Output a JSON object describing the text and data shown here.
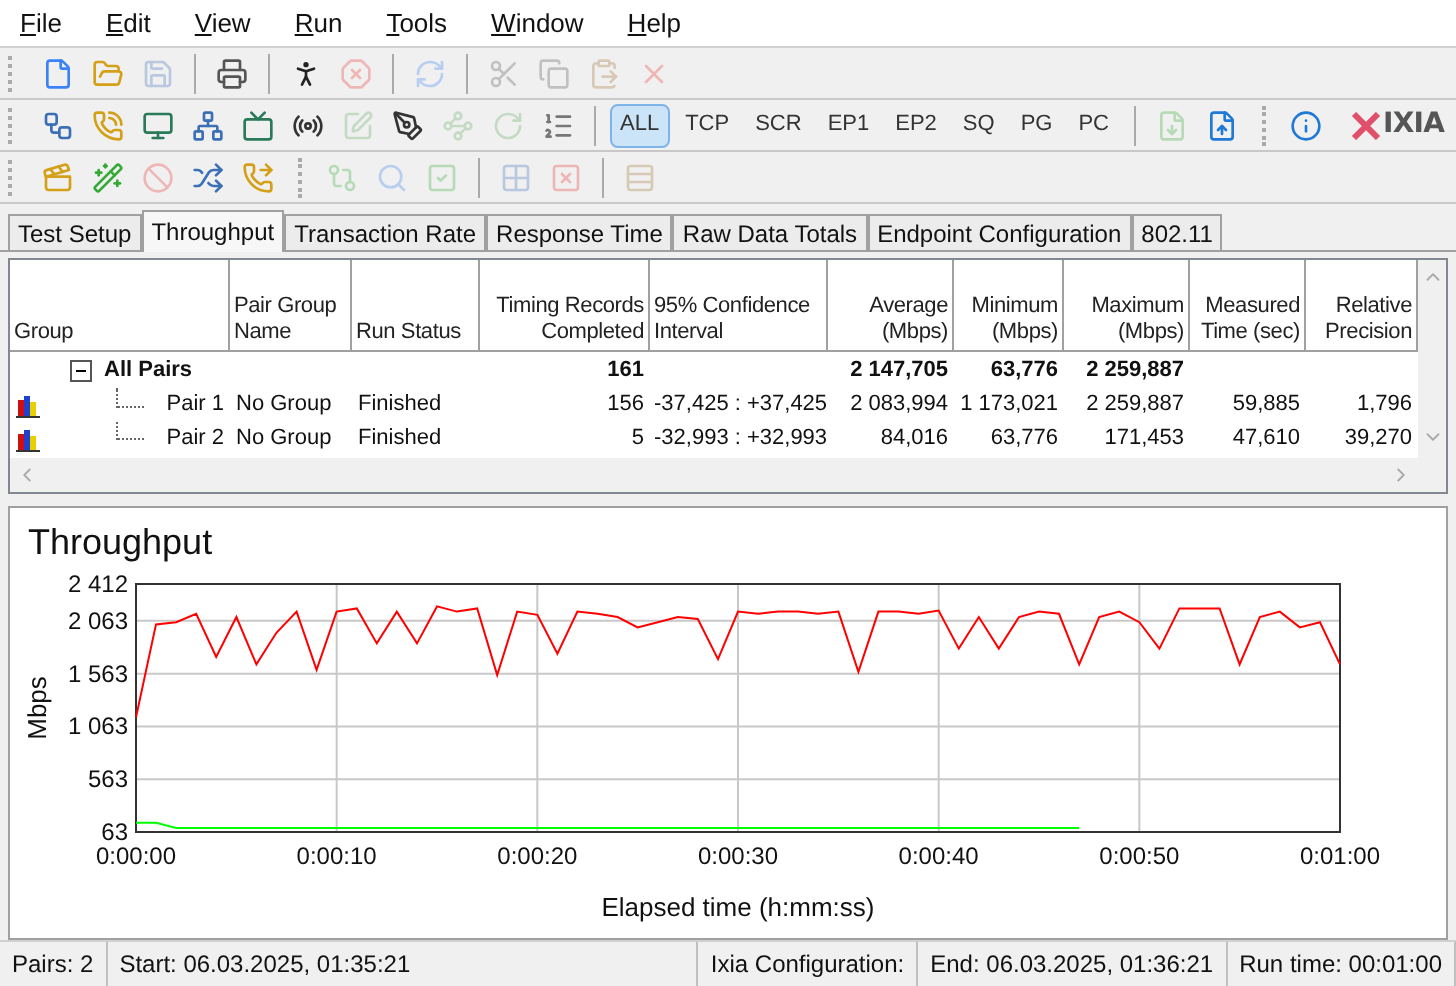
{
  "menu": [
    "File",
    "Edit",
    "View",
    "Run",
    "Tools",
    "Window",
    "Help"
  ],
  "toolbars": [
    {
      "items": [
        {
          "kind": "icon",
          "disabled": false
        },
        {
          "kind": "icon",
          "disabled": false
        },
        {
          "kind": "icon",
          "disabled": true
        },
        {
          "kind": "separator"
        },
        {
          "kind": "icon",
          "disabled": false
        },
        {
          "kind": "separator"
        },
        {
          "kind": "icon",
          "disabled": false
        },
        {
          "kind": "icon",
          "disabled": true
        },
        {
          "kind": "separator"
        },
        {
          "kind": "icon",
          "disabled": true
        },
        {
          "kind": "separator"
        },
        {
          "kind": "icon",
          "disabled": true
        },
        {
          "kind": "icon",
          "disabled": true
        },
        {
          "kind": "icon",
          "disabled": true
        },
        {
          "kind": "icon",
          "disabled": true
        }
      ]
    },
    {
      "items": [
        {
          "kind": "icon",
          "disabled": false
        },
        {
          "kind": "icon",
          "disabled": false
        },
        {
          "kind": "icon",
          "disabled": false
        },
        {
          "kind": "icon",
          "disabled": false
        },
        {
          "kind": "icon",
          "disabled": false
        },
        {
          "kind": "icon",
          "disabled": false
        },
        {
          "kind": "icon",
          "disabled": true
        },
        {
          "kind": "icon",
          "disabled": false
        },
        {
          "kind": "icon",
          "disabled": true
        },
        {
          "kind": "icon",
          "disabled": true
        },
        {
          "kind": "icon",
          "disabled": false
        },
        {
          "kind": "separator"
        },
        {
          "kind": "filter",
          "label": "ALL",
          "selected": true
        },
        {
          "kind": "filter",
          "label": "TCP",
          "selected": false
        },
        {
          "kind": "filter",
          "label": "SCR",
          "selected": false
        },
        {
          "kind": "filter",
          "label": "EP1",
          "selected": false
        },
        {
          "kind": "filter",
          "label": "EP2",
          "selected": false
        },
        {
          "kind": "filter",
          "label": "SQ",
          "selected": false
        },
        {
          "kind": "filter",
          "label": "PG",
          "selected": false
        },
        {
          "kind": "filter",
          "label": "PC",
          "selected": false
        },
        {
          "kind": "separator"
        },
        {
          "kind": "icon",
          "disabled": true
        },
        {
          "kind": "icon",
          "disabled": false
        },
        {
          "kind": "grip"
        },
        {
          "kind": "icon",
          "disabled": false
        },
        {
          "kind": "logo",
          "label": "IXIA"
        }
      ]
    },
    {
      "items": [
        {
          "kind": "icon",
          "disabled": false
        },
        {
          "kind": "icon",
          "disabled": false
        },
        {
          "kind": "icon",
          "disabled": true
        },
        {
          "kind": "icon",
          "disabled": false
        },
        {
          "kind": "icon",
          "disabled": false
        },
        {
          "kind": "grip"
        },
        {
          "kind": "icon",
          "disabled": true
        },
        {
          "kind": "icon",
          "disabled": true
        },
        {
          "kind": "icon",
          "disabled": true
        },
        {
          "kind": "separator"
        },
        {
          "kind": "icon",
          "disabled": true
        },
        {
          "kind": "icon",
          "disabled": true
        },
        {
          "kind": "separator"
        },
        {
          "kind": "icon",
          "disabled": true
        }
      ]
    }
  ],
  "tabs": [
    {
      "label": "Test Setup",
      "selected": false
    },
    {
      "label": "Throughput",
      "selected": true
    },
    {
      "label": "Transaction Rate",
      "selected": false
    },
    {
      "label": "Response Time",
      "selected": false
    },
    {
      "label": "Raw Data Totals",
      "selected": false
    },
    {
      "label": "Endpoint Configuration",
      "selected": false
    },
    {
      "label": "802.11",
      "selected": false
    }
  ],
  "table": {
    "columns": [
      "Group",
      "Pair Group Name",
      "Run Status",
      "Timing Records Completed",
      "95% Confidence Interval",
      "Average (Mbps)",
      "Minimum (Mbps)",
      "Maximum (Mbps)",
      "Measured Time (sec)",
      "Relative Precision"
    ],
    "rows": [
      {
        "expanded": true,
        "cells": [
          "All Pairs",
          "",
          "",
          "161",
          "",
          "2 147,705",
          "63,776",
          "2 259,887",
          "",
          ""
        ],
        "children": [
          {
            "cells": [
              "Pair 1",
              "No Group",
              "Finished",
              "156",
              "-37,425 : +37,425",
              "2 083,994",
              "1 173,021",
              "2 259,887",
              "59,885",
              "1,796"
            ]
          },
          {
            "cells": [
              "Pair 2",
              "No Group",
              "Finished",
              "5",
              "-32,993 : +32,993",
              "84,016",
              "63,776",
              "171,453",
              "47,610",
              "39,270"
            ]
          }
        ]
      }
    ]
  },
  "chart": {
    "title": "Throughput",
    "chart_data": {
      "type": "line",
      "grid": true,
      "xlabel": "Elapsed time (h:mm:ss)",
      "ylabel": "Mbps",
      "x": [
        0,
        1,
        2,
        3,
        4,
        5,
        6,
        7,
        8,
        9,
        10,
        11,
        12,
        13,
        14,
        15,
        16,
        17,
        18,
        19,
        20,
        21,
        22,
        23,
        24,
        25,
        26,
        27,
        28,
        29,
        30,
        31,
        32,
        33,
        34,
        35,
        36,
        37,
        38,
        39,
        40,
        41,
        42,
        43,
        44,
        45,
        46,
        47,
        48,
        49,
        50,
        51,
        52,
        53,
        54,
        55,
        56,
        57,
        58,
        59,
        60
      ],
      "xlim": [
        0,
        60
      ],
      "ylim": [
        63,
        2412
      ],
      "xticks": [
        {
          "value": 0,
          "label": "0:00:00"
        },
        {
          "value": 10,
          "label": "0:00:10"
        },
        {
          "value": 20,
          "label": "0:00:20"
        },
        {
          "value": 30,
          "label": "0:00:30"
        },
        {
          "value": 40,
          "label": "0:00:40"
        },
        {
          "value": 50,
          "label": "0:00:50"
        },
        {
          "value": 60,
          "label": "0:01:00"
        }
      ],
      "yticks": [
        {
          "value": 63,
          "label": "63"
        },
        {
          "value": 563,
          "label": "563"
        },
        {
          "value": 1063,
          "label": "1 063"
        },
        {
          "value": 1563,
          "label": "1 563"
        },
        {
          "value": 2063,
          "label": "2 063"
        },
        {
          "value": 2412,
          "label": "2 412"
        }
      ],
      "series": [
        {
          "color": "#ff0000",
          "values": [
            1150,
            2030,
            2050,
            2130,
            1720,
            2100,
            1650,
            1950,
            2150,
            1600,
            2150,
            2180,
            1850,
            2150,
            1850,
            2200,
            2150,
            2180,
            1550,
            2150,
            2120,
            1750,
            2150,
            2130,
            2100,
            2000,
            2050,
            2100,
            2080,
            1700,
            2150,
            2130,
            2150,
            2150,
            2130,
            2150,
            1580,
            2150,
            2150,
            2130,
            2160,
            1800,
            2100,
            1800,
            2100,
            2150,
            2130,
            1650,
            2100,
            2150,
            2050,
            1800,
            2180,
            2180,
            2180,
            1650,
            2100,
            2150,
            2000,
            2050,
            1650
          ]
        },
        {
          "color": "#00ff00",
          "values": [
            150,
            150,
            100,
            100,
            100,
            100,
            100,
            100,
            100,
            100,
            100,
            100,
            100,
            100,
            100,
            100,
            100,
            100,
            100,
            100,
            100,
            100,
            100,
            100,
            100,
            100,
            100,
            100,
            100,
            100,
            100,
            100,
            100,
            100,
            100,
            100,
            100,
            100,
            100,
            100,
            100,
            100,
            100,
            100,
            100,
            100,
            100,
            100,
            null,
            null,
            null,
            null,
            null,
            null,
            null,
            null,
            null,
            null,
            null,
            null,
            null
          ]
        }
      ]
    }
  },
  "status_bar": [
    "Pairs: 2",
    "Start: 06.03.2025, 01:35:21",
    "Ixia Configuration:",
    "End: 06.03.2025, 01:36:21",
    "Run time: 00:01:00"
  ]
}
